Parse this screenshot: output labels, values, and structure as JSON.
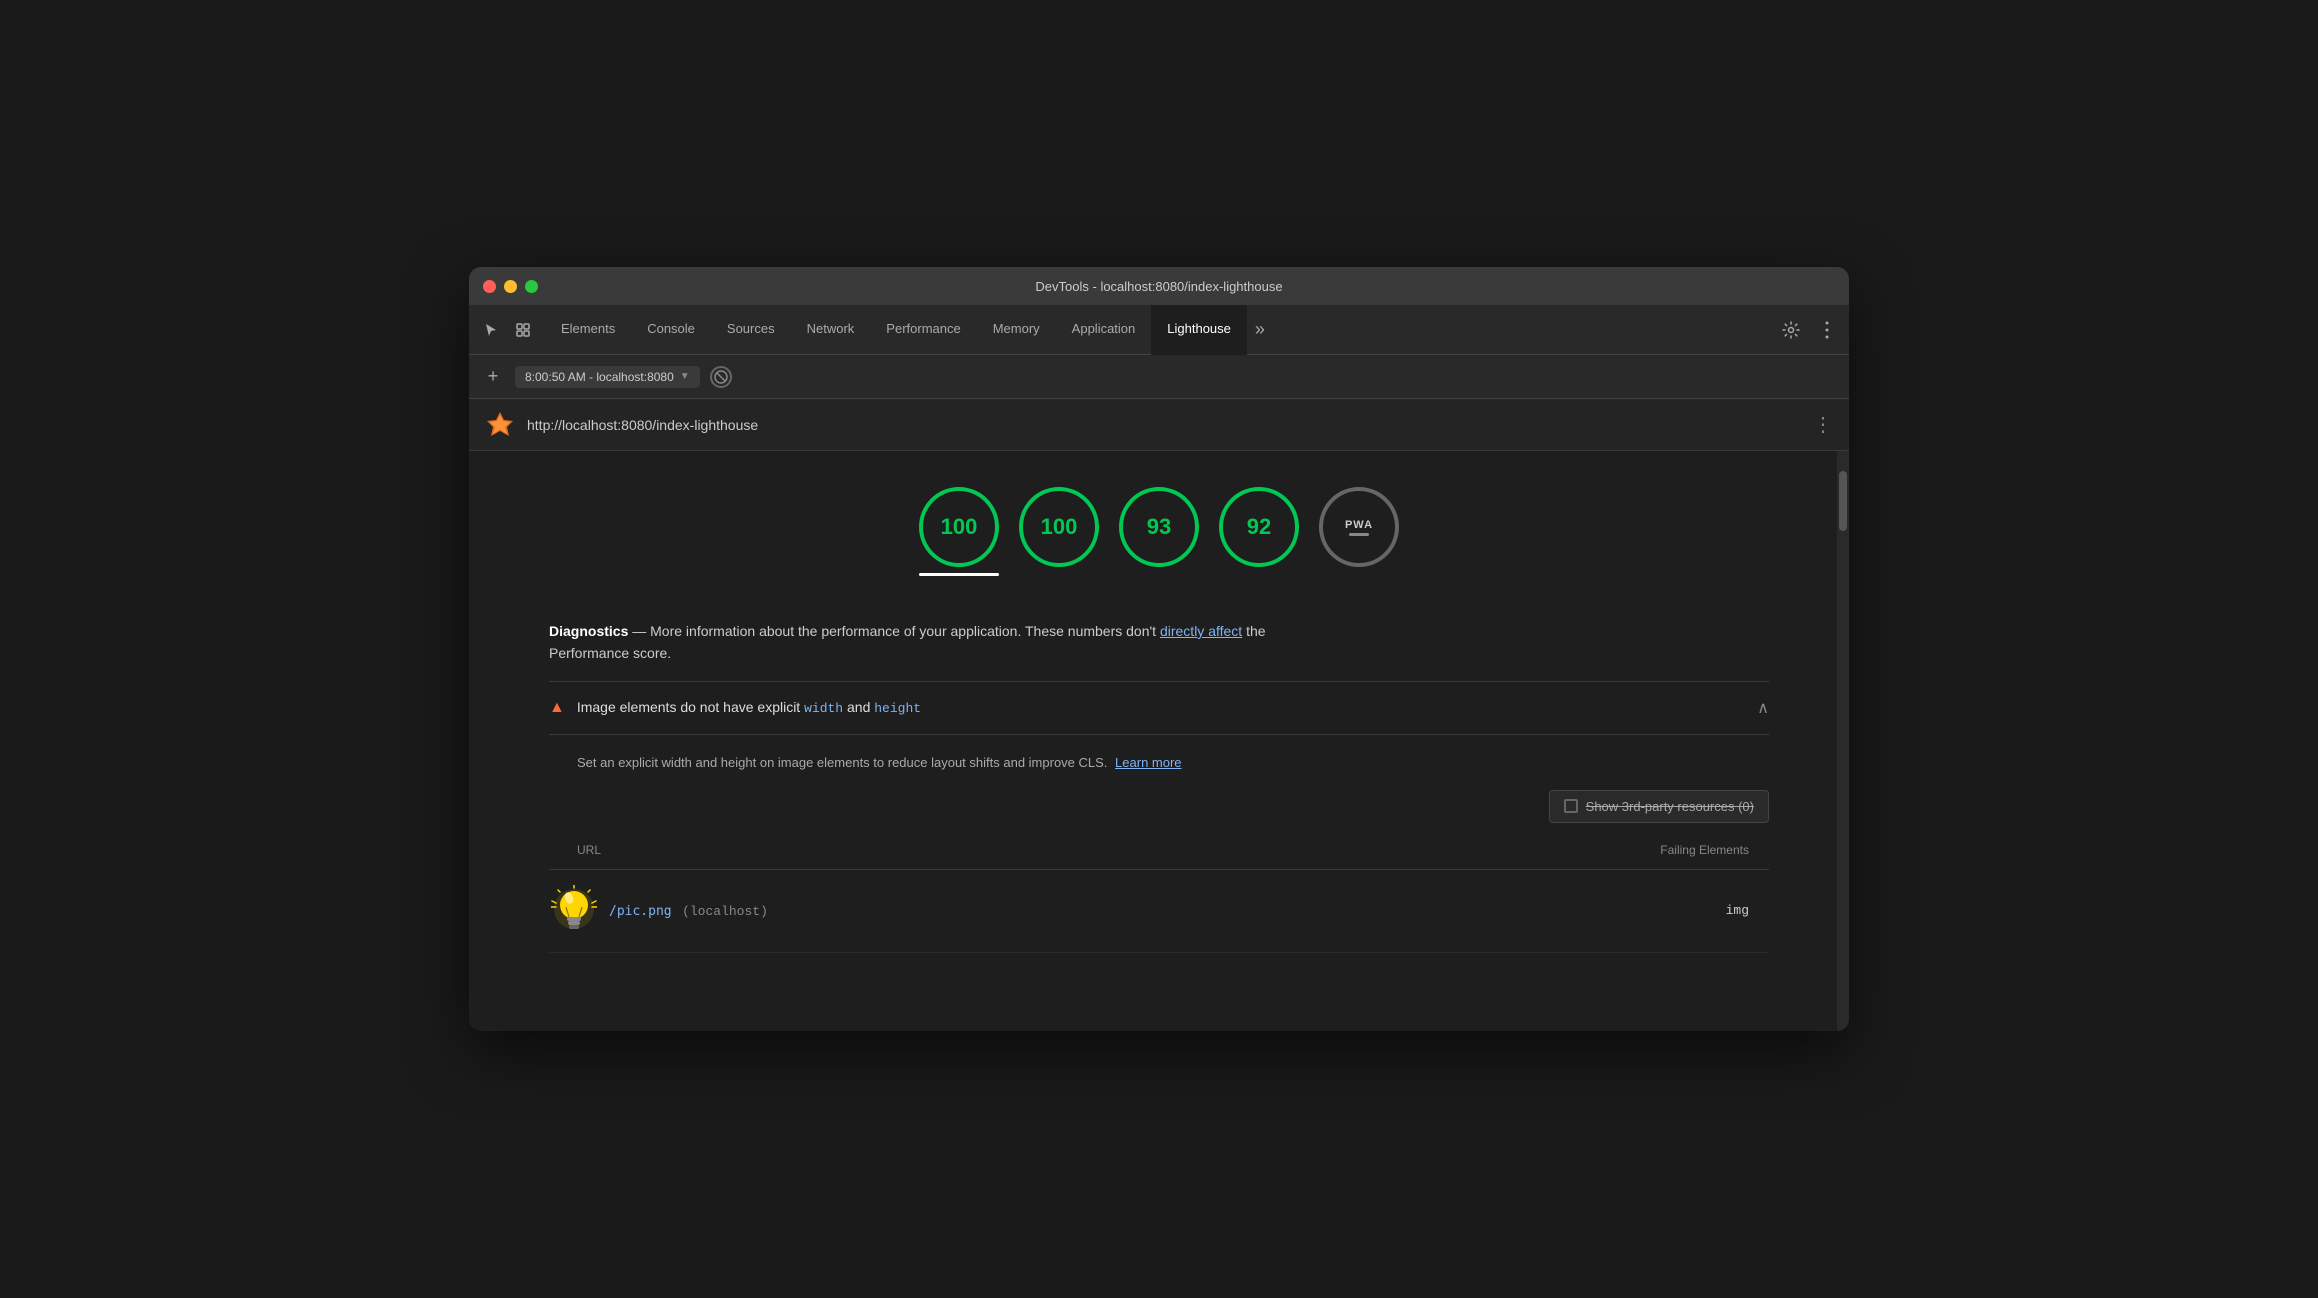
{
  "window": {
    "title": "DevTools - localhost:8080/index-lighthouse"
  },
  "titlebar": {
    "title": "DevTools - localhost:8080/index-lighthouse"
  },
  "tabs": {
    "items": [
      {
        "label": "Elements",
        "active": false
      },
      {
        "label": "Console",
        "active": false
      },
      {
        "label": "Sources",
        "active": false
      },
      {
        "label": "Network",
        "active": false
      },
      {
        "label": "Performance",
        "active": false
      },
      {
        "label": "Memory",
        "active": false
      },
      {
        "label": "Application",
        "active": false
      },
      {
        "label": "Lighthouse",
        "active": true
      }
    ],
    "more_icon": "»"
  },
  "address_bar": {
    "url": "8:00:50 AM - localhost:8080",
    "add_label": "+",
    "stop_icon": "⊘"
  },
  "page_url_bar": {
    "url": "http://localhost:8080/index-lighthouse",
    "more_icon": "⋮"
  },
  "scores": [
    {
      "value": "100",
      "active": true
    },
    {
      "value": "100",
      "active": false
    },
    {
      "value": "93",
      "active": false
    },
    {
      "value": "92",
      "active": false
    },
    {
      "value": "PWA",
      "is_pwa": true
    }
  ],
  "diagnostics": {
    "title": "Diagnostics",
    "description": "— More information about the performance of your application. These numbers don't",
    "link_text": "directly affect",
    "description_end": "the",
    "description2": "Performance score."
  },
  "warning": {
    "title_prefix": "Image elements do not have explicit",
    "code1": "width",
    "title_mid": "and",
    "code2": "height"
  },
  "detail": {
    "description": "Set an explicit width and height on image elements to reduce layout shifts and improve CLS.",
    "link_text": "Learn more",
    "third_party_label": "Show 3rd-party resources (0)",
    "table_header_url": "URL",
    "table_header_failing": "Failing Elements",
    "rows": [
      {
        "url": "/pic.png",
        "host": "(localhost)",
        "failing": "img"
      }
    ]
  }
}
